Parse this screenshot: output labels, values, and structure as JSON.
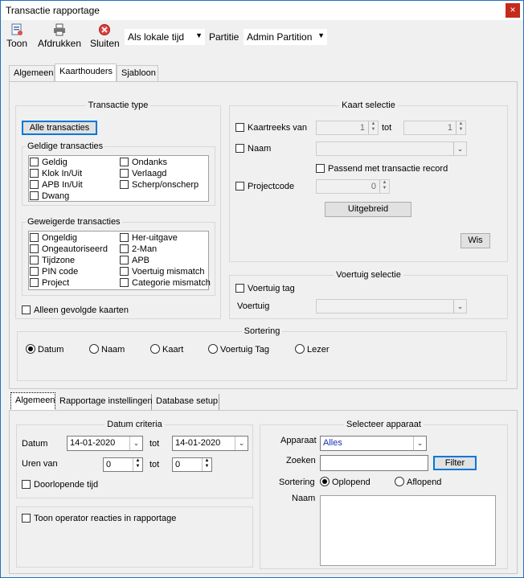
{
  "window": {
    "title": "Transactie rapportage",
    "close_glyph": "×"
  },
  "toolbar": {
    "toon": "Toon",
    "afdrukken": "Afdrukken",
    "sluiten": "Sluiten",
    "time_mode": "Als lokale tijd",
    "partitie_label": "Partitie",
    "partitie_value": "Admin Partition"
  },
  "top_tabs": [
    "Algemeen",
    "Kaarthouders",
    "Sjabloon"
  ],
  "transactie_type": {
    "title": "Transactie type",
    "alle_button": "Alle transacties",
    "geldige_title": "Geldige transacties",
    "geldige_left": [
      "Geldig",
      "Klok In/Uit",
      "APB In/Uit",
      "Dwang"
    ],
    "geldige_right": [
      "Ondanks",
      "Verlaagd",
      "Scherp/onscherp"
    ],
    "geweigerde_title": "Geweigerde transacties",
    "geweigerde_left": [
      "Ongeldig",
      "Ongeautoriseerd",
      "Tijdzone",
      "PIN code",
      "Project"
    ],
    "geweigerde_right": [
      "Her-uitgave",
      "2-Man",
      "APB",
      "Voertuig mismatch",
      "Categorie mismatch"
    ],
    "alleen_gevolgde": "Alleen gevolgde kaarten"
  },
  "kaart_selectie": {
    "title": "Kaart selectie",
    "kaartreeks": "Kaartreeks van",
    "from_value": "1",
    "tot": "tot",
    "to_value": "1",
    "naam": "Naam",
    "passend": "Passend met transactie record",
    "projectcode": "Projectcode",
    "project_value": "0",
    "uitgebreid": "Uitgebreid",
    "wis": "Wis"
  },
  "voertuig": {
    "title": "Voertuig selectie",
    "tag": "Voertuig tag",
    "label": "Voertuig"
  },
  "sortering": {
    "title": "Sortering",
    "options": [
      "Datum",
      "Naam",
      "Kaart",
      "Voertuig Tag",
      "Lezer"
    ],
    "selected": "Datum"
  },
  "bottom_tabs": [
    "Algemeen",
    "Rapportage instellingen",
    "Database setup"
  ],
  "datum_criteria": {
    "title": "Datum criteria",
    "datum": "Datum",
    "from": "14-01-2020",
    "tot": "tot",
    "to": "14-01-2020",
    "uren_van": "Uren van",
    "uren_from": "0",
    "uren_to": "0",
    "doorlopende": "Doorlopende tijd"
  },
  "operator": {
    "label": "Toon operator reacties in rapportage"
  },
  "apparaat": {
    "title": "Selecteer apparaat",
    "apparaat_label": "Apparaat",
    "apparaat_value": "Alles",
    "zoeken": "Zoeken",
    "filter": "Filter",
    "sortering": "Sortering",
    "oplopend": "Oplopend",
    "aflopend": "Aflopend",
    "naam": "Naam"
  },
  "colors": {
    "accent": "#0078d7",
    "close_red": "#c42b1c",
    "blue_text": "#1a2fb0"
  }
}
